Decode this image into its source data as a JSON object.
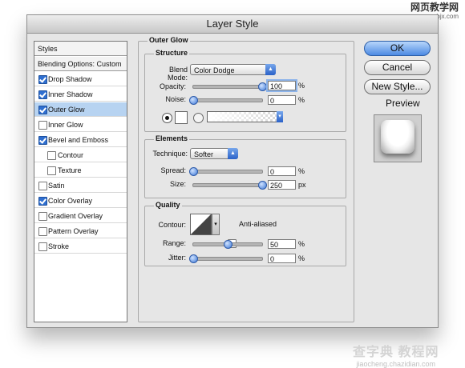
{
  "watermark": {
    "top_cn": "网页教学网",
    "top_url": "www.webjx.com",
    "bottom_cn": "查字典 教程网",
    "bottom_url": "jiaocheng.chazidian.com"
  },
  "dialog": {
    "title": "Layer Style"
  },
  "styles_list": {
    "header": "Styles",
    "blending": "Blending Options: Custom",
    "items": [
      {
        "label": "Drop Shadow",
        "checked": true
      },
      {
        "label": "Inner Shadow",
        "checked": true
      },
      {
        "label": "Outer Glow",
        "checked": true,
        "selected": true
      },
      {
        "label": "Inner Glow",
        "checked": false
      },
      {
        "label": "Bevel and Emboss",
        "checked": true
      },
      {
        "label": "Contour",
        "checked": false,
        "indent": true
      },
      {
        "label": "Texture",
        "checked": false,
        "indent": true
      },
      {
        "label": "Satin",
        "checked": false
      },
      {
        "label": "Color Overlay",
        "checked": true
      },
      {
        "label": "Gradient Overlay",
        "checked": false
      },
      {
        "label": "Pattern Overlay",
        "checked": false
      },
      {
        "label": "Stroke",
        "checked": false
      }
    ]
  },
  "outer_glow": {
    "title": "Outer Glow",
    "structure": {
      "title": "Structure",
      "blend_mode_label": "Blend Mode:",
      "blend_mode_value": "Color Dodge",
      "opacity_label": "Opacity:",
      "opacity_value": "100",
      "opacity_level": 1.0,
      "noise_label": "Noise:",
      "noise_value": "0",
      "noise_level": 0.0,
      "percent": "%"
    },
    "elements": {
      "title": "Elements",
      "technique_label": "Technique:",
      "technique_value": "Softer",
      "spread_label": "Spread:",
      "spread_value": "0",
      "spread_level": 0.0,
      "size_label": "Size:",
      "size_value": "250",
      "size_level": 1.0,
      "px": "px"
    },
    "quality": {
      "title": "Quality",
      "contour_label": "Contour:",
      "anti_aliased_label": "Anti-aliased",
      "anti_aliased_checked": false,
      "range_label": "Range:",
      "range_value": "50",
      "range_level": 0.5,
      "jitter_label": "Jitter:",
      "jitter_value": "0",
      "jitter_level": 0.0
    }
  },
  "buttons": {
    "ok": "OK",
    "cancel": "Cancel",
    "new_style": "New Style...",
    "preview_label": "Preview",
    "preview_checked": true
  }
}
